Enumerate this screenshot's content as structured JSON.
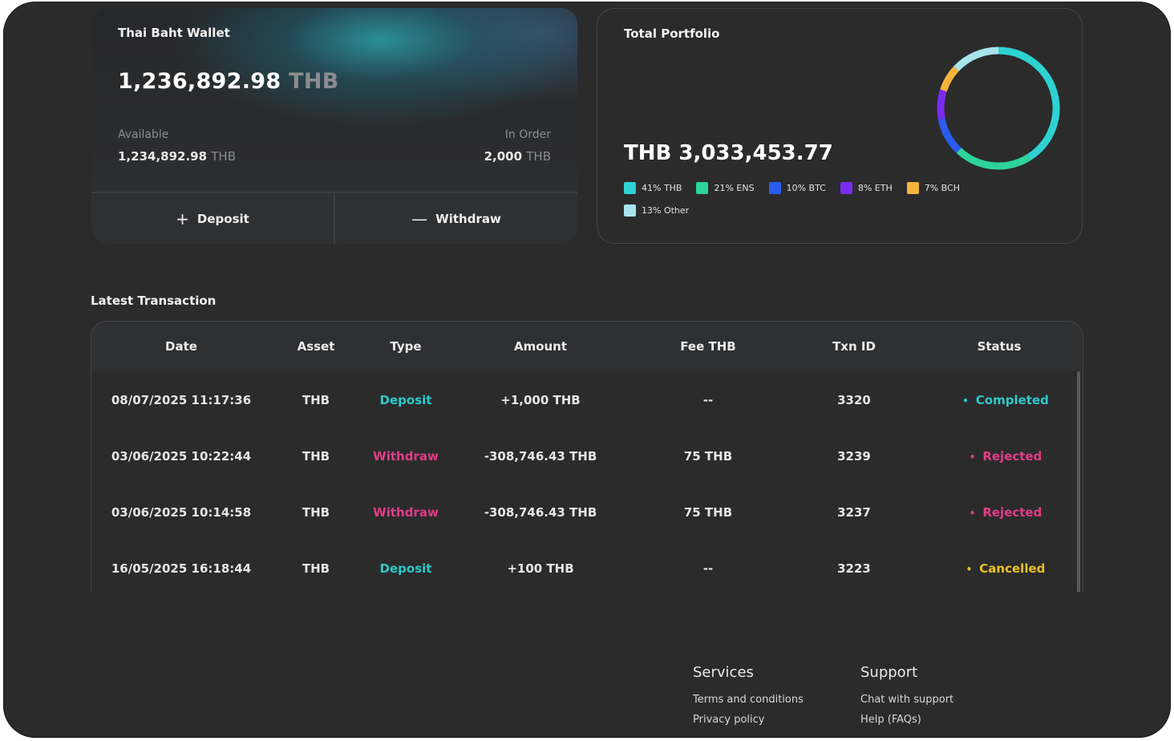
{
  "wallet": {
    "title": "Thai Baht Wallet",
    "balance": "1,236,892.98",
    "balance_unit": "THB",
    "available_label": "Available",
    "available_value": "1,234,892.98",
    "available_unit": "THB",
    "in_order_label": "In Order",
    "in_order_value": "2,000",
    "in_order_unit": "THB",
    "deposit_label": "Deposit",
    "withdraw_label": "Withdraw",
    "deposit_icon": "plus-icon",
    "withdraw_icon": "minus-icon"
  },
  "portfolio": {
    "title": "Total Portfolio",
    "total": "THB 3,033,453.77",
    "legend": [
      {
        "label": "41% THB",
        "color": "#2ed3d1",
        "pct": 41
      },
      {
        "label": "21% ENS",
        "color": "#2ed39a",
        "pct": 21
      },
      {
        "label": "10% BTC",
        "color": "#2a5cf0",
        "pct": 10
      },
      {
        "label": "8% ETH",
        "color": "#7a2cf0",
        "pct": 8
      },
      {
        "label": "7% BCH",
        "color": "#f4b53a",
        "pct": 7
      },
      {
        "label": "13% Other",
        "color": "#a8e4ec",
        "pct": 13
      }
    ]
  },
  "transactions": {
    "title": "Latest Transaction",
    "columns": [
      "Date",
      "Asset",
      "Type",
      "Amount",
      "Fee THB",
      "Txn ID",
      "Status"
    ],
    "rows": [
      {
        "date": "08/07/2025 11:17:36",
        "asset": "THB",
        "type": "Deposit",
        "amount": "+1,000 THB",
        "fee": "--",
        "txn": "3320",
        "status": "Completed",
        "status_color": "#2ec9c8"
      },
      {
        "date": "03/06/2025 10:22:44",
        "asset": "THB",
        "type": "Withdraw",
        "amount": "-308,746.43 THB",
        "fee": "75 THB",
        "txn": "3239",
        "status": "Rejected",
        "status_color": "#e23d84"
      },
      {
        "date": "03/06/2025 10:14:58",
        "asset": "THB",
        "type": "Withdraw",
        "amount": "-308,746.43 THB",
        "fee": "75 THB",
        "txn": "3237",
        "status": "Rejected",
        "status_color": "#e23d84"
      },
      {
        "date": "16/05/2025 16:18:44",
        "asset": "THB",
        "type": "Deposit",
        "amount": "+100 THB",
        "fee": "--",
        "txn": "3223",
        "status": "Cancelled",
        "status_color": "#e8c227"
      }
    ]
  },
  "footer": {
    "services": {
      "title": "Services",
      "links": [
        "Terms and conditions",
        "Privacy policy"
      ]
    },
    "support": {
      "title": "Support",
      "links": [
        "Chat with support",
        "Help (FAQs)"
      ]
    }
  }
}
